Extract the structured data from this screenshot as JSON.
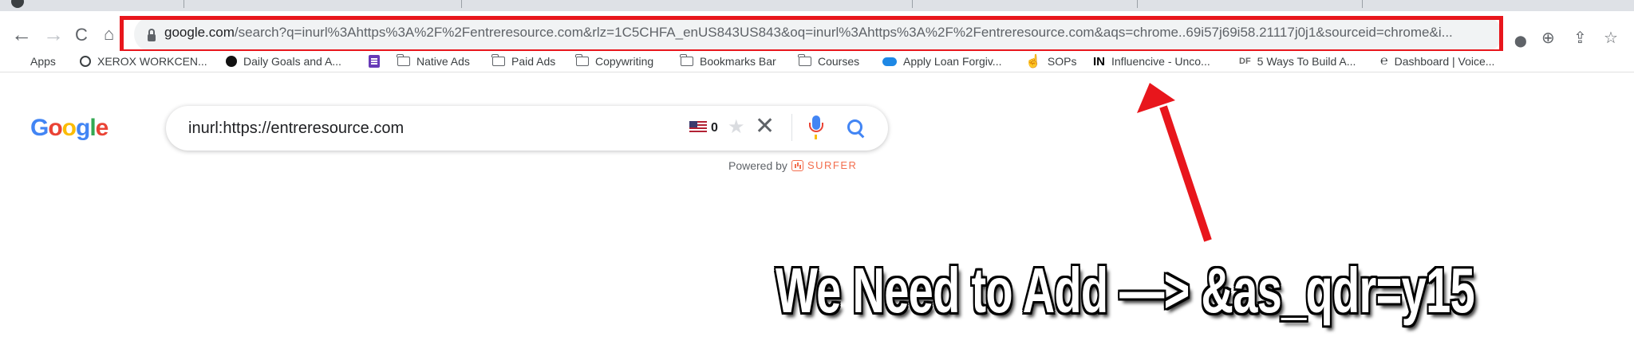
{
  "browser": {
    "url_host": "google.com",
    "url_rest": "/search?q=inurl%3Ahttps%3A%2F%2Fentreresource.com&rlz=1C5CHFA_enUS843US843&oq=inurl%3Ahttps%3A%2F%2Fentreresource.com&aqs=chrome..69i57j69i58.21117j0j1&sourceid=chrome&i...",
    "nav": {
      "back": "←",
      "forward": "→",
      "reload": "C",
      "home": "⌂"
    },
    "toolbar_icons": {
      "location": "⬤",
      "zoom": "⊕",
      "share": "⇪",
      "bookmark_star": "☆"
    }
  },
  "bookmarks": [
    {
      "label": "Apps",
      "icon": "apps-grid-icon"
    },
    {
      "label": "XEROX WORKCEN...",
      "icon": "globe-icon"
    },
    {
      "label": "Daily Goals and A...",
      "icon": "black-dot-icon"
    },
    {
      "label": "",
      "icon": "sheets-icon"
    },
    {
      "label": "Native Ads",
      "icon": "folder-icon"
    },
    {
      "label": "Paid Ads",
      "icon": "folder-icon"
    },
    {
      "label": "Copywriting",
      "icon": "folder-icon"
    },
    {
      "label": "Bookmarks Bar",
      "icon": "folder-icon"
    },
    {
      "label": "Courses",
      "icon": "folder-icon"
    },
    {
      "label": "Apply Loan Forgiv...",
      "icon": "cloud-icon"
    },
    {
      "label": "SOPs",
      "icon": "hand-icon"
    },
    {
      "label": "Influencive - Unco...",
      "icon": "in-logo-icon",
      "icon_text": "IN"
    },
    {
      "label": "5 Ways To Build A...",
      "icon": "df-logo-icon",
      "icon_text": "DF"
    },
    {
      "label": "Dashboard | Voice...",
      "icon": "ear-icon"
    }
  ],
  "google": {
    "logo_letters": [
      "G",
      "o",
      "o",
      "g",
      "l",
      "e"
    ],
    "logo_colors": [
      "#4285f4",
      "#ea4335",
      "#fbbc05",
      "#4285f4",
      "#34a853",
      "#ea4335"
    ],
    "query": "inurl:https://entreresource.com",
    "count": "0",
    "clear_symbol": "✕",
    "star_symbol": "★",
    "powered_by": "Powered by",
    "surfer_label": "SURFER"
  },
  "annotation": {
    "text": "We Need to Add —> &as_qdr=y15",
    "highlight_color": "#e8161c"
  }
}
